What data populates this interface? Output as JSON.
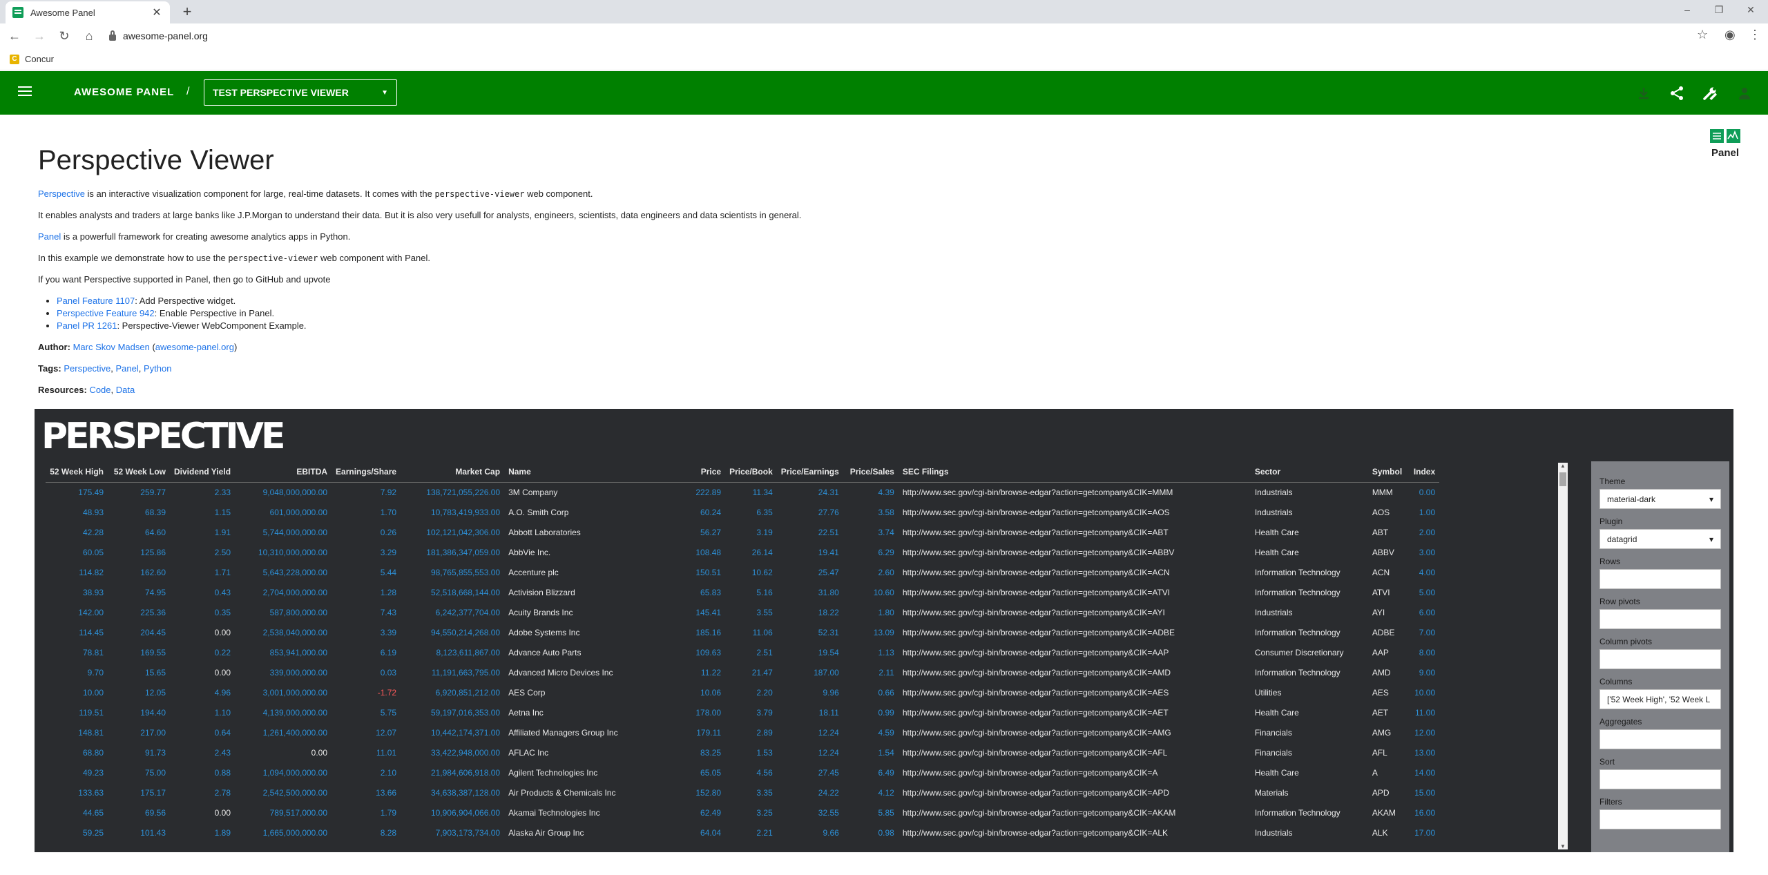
{
  "browser": {
    "tab_title": "Awesome Panel",
    "url": "awesome-panel.org",
    "bookmark": "Concur"
  },
  "header": {
    "brand": "AWESOME PANEL",
    "separator": "/",
    "app_select": "TEST PERSPECTIVE VIEWER"
  },
  "content": {
    "title": "Perspective Viewer",
    "p1_link": "Perspective",
    "p1_a": " is an interactive visualization component for large, real-time datasets. It comes with the ",
    "p1_code": "perspective-viewer",
    "p1_b": " web component.",
    "p2": "It enables analysts and traders at large banks like J.P.Morgan to understand their data. But it is also very usefull for analysts, engineers, scientists, data engineers and data scientists in general.",
    "p3_link": "Panel",
    "p3": " is a powerfull framework for creating awesome analytics apps in Python.",
    "p4_a": "In this example we demonstrate how to use the ",
    "p4_code": "perspective-viewer",
    "p4_b": " web component with Panel.",
    "p5": "If you want Perspective supported in Panel, then go to GitHub and upvote",
    "features": [
      {
        "link": "Panel Feature 1107",
        "text": ": Add Perspective widget."
      },
      {
        "link": "Perspective Feature 942",
        "text": ": Enable Perspective in Panel."
      },
      {
        "link": "Panel PR 1261",
        "text": ": Perspective-Viewer WebComponent Example."
      }
    ],
    "author_label": "Author:",
    "author": "Marc Skov Madsen",
    "author_site": "awesome-panel.org",
    "tags_label": "Tags:",
    "tags": [
      "Perspective",
      "Panel",
      "Python"
    ],
    "resources_label": "Resources:",
    "resources": [
      "Code",
      "Data"
    ],
    "panel_logo_text": "Panel"
  },
  "viewer": {
    "logo": "PERSPECTIVE",
    "columns": [
      "52 Week High",
      "52 Week Low",
      "Dividend Yield",
      "EBITDA",
      "Earnings/Share",
      "Market Cap",
      "Name",
      "Price",
      "Price/Book",
      "Price/Earnings",
      "Price/Sales",
      "SEC Filings",
      "Sector",
      "Symbol",
      "Index"
    ],
    "rows": [
      [
        "175.49",
        "259.77",
        "2.33",
        "9,048,000,000.00",
        "7.92",
        "138,721,055,226.00",
        "3M Company",
        "222.89",
        "11.34",
        "24.31",
        "4.39",
        "http://www.sec.gov/cgi-bin/browse-edgar?action=getcompany&CIK=MMM",
        "Industrials",
        "MMM",
        "0.00"
      ],
      [
        "48.93",
        "68.39",
        "1.15",
        "601,000,000.00",
        "1.70",
        "10,783,419,933.00",
        "A.O. Smith Corp",
        "60.24",
        "6.35",
        "27.76",
        "3.58",
        "http://www.sec.gov/cgi-bin/browse-edgar?action=getcompany&CIK=AOS",
        "Industrials",
        "AOS",
        "1.00"
      ],
      [
        "42.28",
        "64.60",
        "1.91",
        "5,744,000,000.00",
        "0.26",
        "102,121,042,306.00",
        "Abbott Laboratories",
        "56.27",
        "3.19",
        "22.51",
        "3.74",
        "http://www.sec.gov/cgi-bin/browse-edgar?action=getcompany&CIK=ABT",
        "Health Care",
        "ABT",
        "2.00"
      ],
      [
        "60.05",
        "125.86",
        "2.50",
        "10,310,000,000.00",
        "3.29",
        "181,386,347,059.00",
        "AbbVie Inc.",
        "108.48",
        "26.14",
        "19.41",
        "6.29",
        "http://www.sec.gov/cgi-bin/browse-edgar?action=getcompany&CIK=ABBV",
        "Health Care",
        "ABBV",
        "3.00"
      ],
      [
        "114.82",
        "162.60",
        "1.71",
        "5,643,228,000.00",
        "5.44",
        "98,765,855,553.00",
        "Accenture plc",
        "150.51",
        "10.62",
        "25.47",
        "2.60",
        "http://www.sec.gov/cgi-bin/browse-edgar?action=getcompany&CIK=ACN",
        "Information Technology",
        "ACN",
        "4.00"
      ],
      [
        "38.93",
        "74.95",
        "0.43",
        "2,704,000,000.00",
        "1.28",
        "52,518,668,144.00",
        "Activision Blizzard",
        "65.83",
        "5.16",
        "31.80",
        "10.60",
        "http://www.sec.gov/cgi-bin/browse-edgar?action=getcompany&CIK=ATVI",
        "Information Technology",
        "ATVI",
        "5.00"
      ],
      [
        "142.00",
        "225.36",
        "0.35",
        "587,800,000.00",
        "7.43",
        "6,242,377,704.00",
        "Acuity Brands Inc",
        "145.41",
        "3.55",
        "18.22",
        "1.80",
        "http://www.sec.gov/cgi-bin/browse-edgar?action=getcompany&CIK=AYI",
        "Industrials",
        "AYI",
        "6.00"
      ],
      [
        "114.45",
        "204.45",
        "0.00",
        "2,538,040,000.00",
        "3.39",
        "94,550,214,268.00",
        "Adobe Systems Inc",
        "185.16",
        "11.06",
        "52.31",
        "13.09",
        "http://www.sec.gov/cgi-bin/browse-edgar?action=getcompany&CIK=ADBE",
        "Information Technology",
        "ADBE",
        "7.00"
      ],
      [
        "78.81",
        "169.55",
        "0.22",
        "853,941,000.00",
        "6.19",
        "8,123,611,867.00",
        "Advance Auto Parts",
        "109.63",
        "2.51",
        "19.54",
        "1.13",
        "http://www.sec.gov/cgi-bin/browse-edgar?action=getcompany&CIK=AAP",
        "Consumer Discretionary",
        "AAP",
        "8.00"
      ],
      [
        "9.70",
        "15.65",
        "0.00",
        "339,000,000.00",
        "0.03",
        "11,191,663,795.00",
        "Advanced Micro Devices Inc",
        "11.22",
        "21.47",
        "187.00",
        "2.11",
        "http://www.sec.gov/cgi-bin/browse-edgar?action=getcompany&CIK=AMD",
        "Information Technology",
        "AMD",
        "9.00"
      ],
      [
        "10.00",
        "12.05",
        "4.96",
        "3,001,000,000.00",
        "-1.72",
        "6,920,851,212.00",
        "AES Corp",
        "10.06",
        "2.20",
        "9.96",
        "0.66",
        "http://www.sec.gov/cgi-bin/browse-edgar?action=getcompany&CIK=AES",
        "Utilities",
        "AES",
        "10.00"
      ],
      [
        "119.51",
        "194.40",
        "1.10",
        "4,139,000,000.00",
        "5.75",
        "59,197,016,353.00",
        "Aetna Inc",
        "178.00",
        "3.79",
        "18.11",
        "0.99",
        "http://www.sec.gov/cgi-bin/browse-edgar?action=getcompany&CIK=AET",
        "Health Care",
        "AET",
        "11.00"
      ],
      [
        "148.81",
        "217.00",
        "0.64",
        "1,261,400,000.00",
        "12.07",
        "10,442,174,371.00",
        "Affiliated Managers Group Inc",
        "179.11",
        "2.89",
        "12.24",
        "4.59",
        "http://www.sec.gov/cgi-bin/browse-edgar?action=getcompany&CIK=AMG",
        "Financials",
        "AMG",
        "12.00"
      ],
      [
        "68.80",
        "91.73",
        "2.43",
        "0.00",
        "11.01",
        "33,422,948,000.00",
        "AFLAC Inc",
        "83.25",
        "1.53",
        "12.24",
        "1.54",
        "http://www.sec.gov/cgi-bin/browse-edgar?action=getcompany&CIK=AFL",
        "Financials",
        "AFL",
        "13.00"
      ],
      [
        "49.23",
        "75.00",
        "0.88",
        "1,094,000,000.00",
        "2.10",
        "21,984,606,918.00",
        "Agilent Technologies Inc",
        "65.05",
        "4.56",
        "27.45",
        "6.49",
        "http://www.sec.gov/cgi-bin/browse-edgar?action=getcompany&CIK=A",
        "Health Care",
        "A",
        "14.00"
      ],
      [
        "133.63",
        "175.17",
        "2.78",
        "2,542,500,000.00",
        "13.66",
        "34,638,387,128.00",
        "Air Products & Chemicals Inc",
        "152.80",
        "3.35",
        "24.22",
        "4.12",
        "http://www.sec.gov/cgi-bin/browse-edgar?action=getcompany&CIK=APD",
        "Materials",
        "APD",
        "15.00"
      ],
      [
        "44.65",
        "69.56",
        "0.00",
        "789,517,000.00",
        "1.79",
        "10,906,904,066.00",
        "Akamai Technologies Inc",
        "62.49",
        "3.25",
        "32.55",
        "5.85",
        "http://www.sec.gov/cgi-bin/browse-edgar?action=getcompany&CIK=AKAM",
        "Information Technology",
        "AKAM",
        "16.00"
      ],
      [
        "59.25",
        "101.43",
        "1.89",
        "1,665,000,000.00",
        "8.28",
        "7,903,173,734.00",
        "Alaska Air Group Inc",
        "64.04",
        "2.21",
        "9.66",
        "0.98",
        "http://www.sec.gov/cgi-bin/browse-edgar?action=getcompany&CIK=ALK",
        "Industrials",
        "ALK",
        "17.00"
      ]
    ],
    "sidebar": {
      "theme_label": "Theme",
      "theme_value": "material-dark",
      "plugin_label": "Plugin",
      "plugin_value": "datagrid",
      "rows_label": "Rows",
      "rows_value": "",
      "row_pivots_label": "Row pivots",
      "row_pivots_value": "",
      "column_pivots_label": "Column pivots",
      "column_pivots_value": "",
      "columns_label": "Columns",
      "columns_value": "['52 Week High', '52 Week L",
      "aggregates_label": "Aggregates",
      "aggregates_value": "",
      "sort_label": "Sort",
      "sort_value": "",
      "filters_label": "Filters",
      "filters_value": ""
    }
  },
  "colors": {
    "header_green": "#008000",
    "link_blue": "#1e73e8",
    "viewer_bg": "#2a2c2f",
    "value_blue": "#2d8fd5",
    "negative_red": "#ff5a5a"
  }
}
